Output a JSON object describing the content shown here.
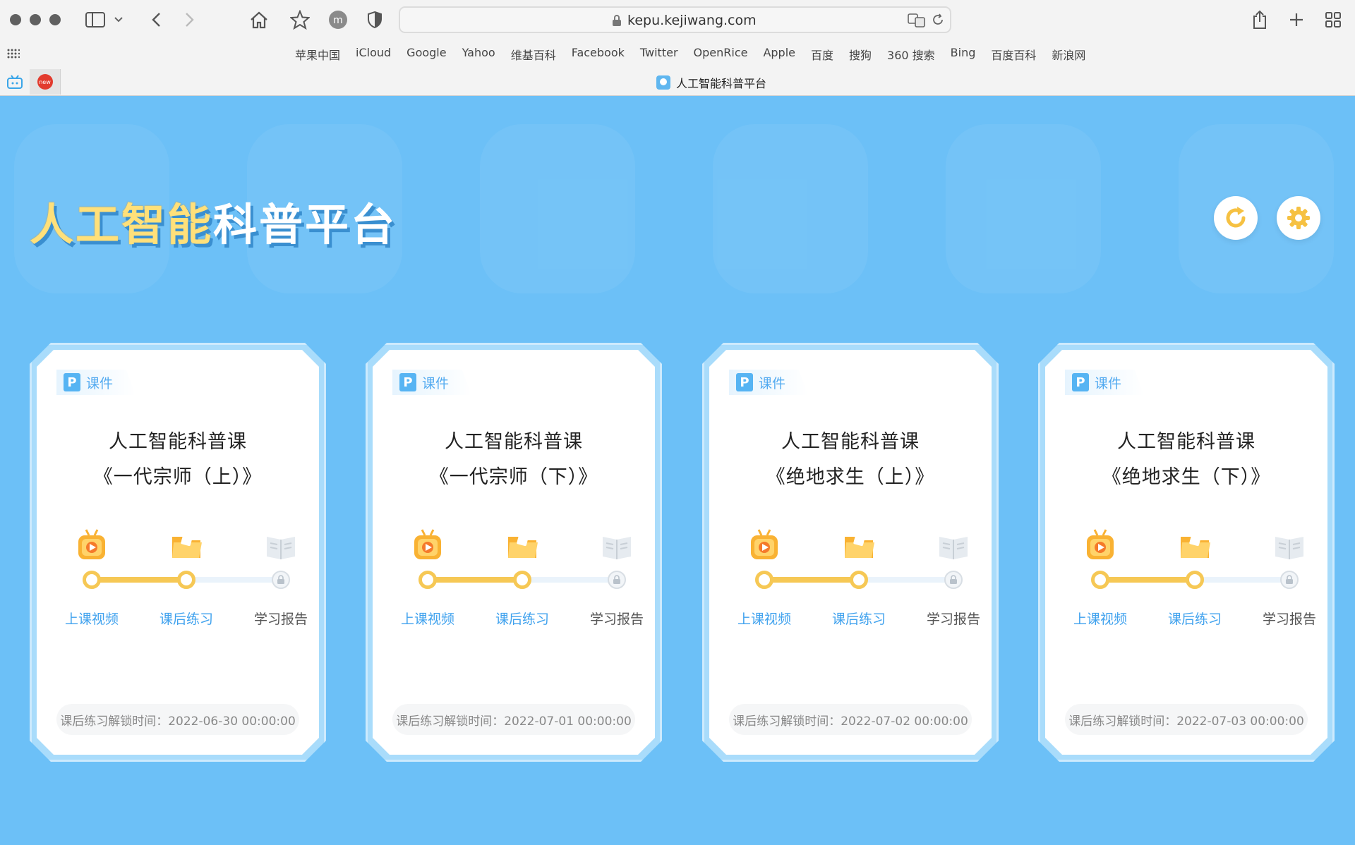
{
  "browser": {
    "url": "kepu.kejiwang.com",
    "tab_title": "人工智能科普平台",
    "bookmarks": [
      "苹果中国",
      "iCloud",
      "Google",
      "Yahoo",
      "维基百科",
      "Facebook",
      "Twitter",
      "OpenRice",
      "Apple",
      "百度",
      "搜狗",
      "360 搜索",
      "Bing",
      "百度百科",
      "新浪网"
    ],
    "pinned_tab_badge": "new"
  },
  "page": {
    "title_part1": "人工智能",
    "title_part2": "科普平台",
    "refresh_icon": "refresh-icon",
    "settings_icon": "gear-icon",
    "accent_color": "#f6c855",
    "primary_color": "#40a2ee",
    "background_color": "#6cc0f7"
  },
  "cards": [
    {
      "tag": "课件",
      "tag_letter": "P",
      "title_line1": "人工智能科普课",
      "title_line2": "《一代宗师（上）》",
      "steps": [
        "上课视频",
        "课后练习",
        "学习报告"
      ],
      "unlock_text": "课后练习解锁时间：2022-06-30 00:00:00"
    },
    {
      "tag": "课件",
      "tag_letter": "P",
      "title_line1": "人工智能科普课",
      "title_line2": "《一代宗师（下）》",
      "steps": [
        "上课视频",
        "课后练习",
        "学习报告"
      ],
      "unlock_text": "课后练习解锁时间：2022-07-01 00:00:00"
    },
    {
      "tag": "课件",
      "tag_letter": "P",
      "title_line1": "人工智能科普课",
      "title_line2": "《绝地求生（上）》",
      "steps": [
        "上课视频",
        "课后练习",
        "学习报告"
      ],
      "unlock_text": "课后练习解锁时间：2022-07-02 00:00:00"
    },
    {
      "tag": "课件",
      "tag_letter": "P",
      "title_line1": "人工智能科普课",
      "title_line2": "《绝地求生（下）》",
      "steps": [
        "上课视频",
        "课后练习",
        "学习报告"
      ],
      "unlock_text": "课后练习解锁时间：2022-07-03 00:00:00"
    }
  ]
}
